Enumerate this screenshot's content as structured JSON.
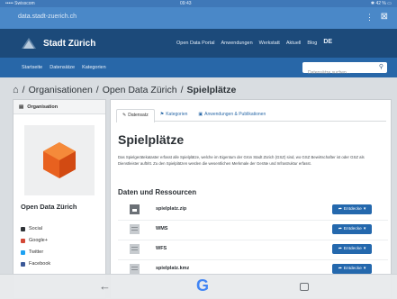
{
  "status": {
    "left": "••••• Swisscom",
    "center": "09:43",
    "right": "✱ 42 % ▭"
  },
  "browser": {
    "url": "data.stadt-zuerich.ch",
    "menu_icon": "more-vert-icon",
    "close_icon": "close-icon"
  },
  "header": {
    "site_title": "Stadt Zürich",
    "nav": [
      "Open Data Portal",
      "Anwendungen",
      "Werkstatt",
      "Aktuell",
      "Blog"
    ],
    "lang": "DE",
    "accent": "#1c4a7a"
  },
  "subnav": {
    "links": [
      "Startseite",
      "Datensätze",
      "Kategorien"
    ],
    "search_placeholder": "Datensätze suchen..."
  },
  "breadcrumb": {
    "org": "Organisationen",
    "site": "Open Data Zürich",
    "current": "Spielplätze"
  },
  "left": {
    "heading": "Organisation",
    "org_name": "Open Data Zürich",
    "social": [
      {
        "label": "Social",
        "color": "#2f3337"
      },
      {
        "label": "Google+",
        "color": "#d34836"
      },
      {
        "label": "Twitter",
        "color": "#1da1f2"
      },
      {
        "label": "Facebook",
        "color": "#3b5998"
      }
    ]
  },
  "tabs": [
    "Datensatz",
    "Kategorien",
    "Anwendungen & Publikationen"
  ],
  "dataset": {
    "title": "Spielplätze",
    "description": "Das Spielgerätekataster erfasst alle Spielplätze, welche im Eigentum der Grün Stadt Zürich (GSZ) sind, wo GSZ Bewirtschafter ist oder GSZ als Dienstleister auftritt. Zu den Spielplätzen werden die wesentlichen Merkmale der Geräte und Infrastruktur erfasst.",
    "resources_heading": "Daten und Ressourcen",
    "resources": [
      {
        "name": "spielplatz.zip",
        "button": "Entdecke"
      },
      {
        "name": "WMS",
        "button": "Entdecke"
      },
      {
        "name": "WFS",
        "button": "Entdecke"
      },
      {
        "name": "spielplatz.kmz",
        "button": "Entdecke"
      }
    ]
  },
  "navbar": {
    "back": "←",
    "home": "G"
  }
}
